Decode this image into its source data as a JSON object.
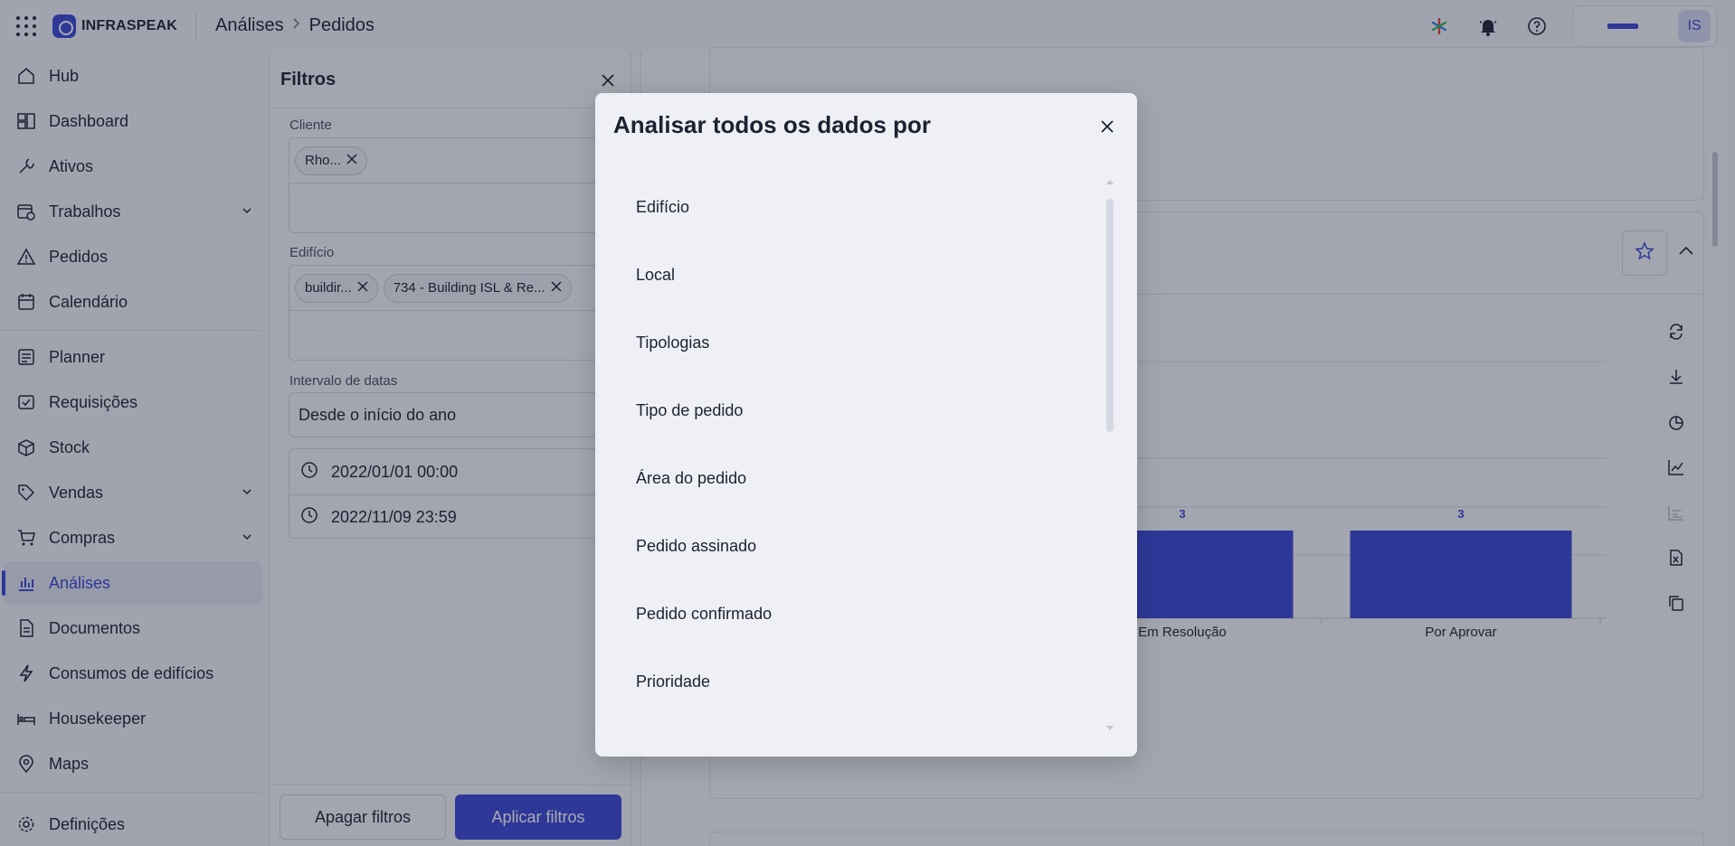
{
  "topbar": {
    "brand": "INFRASPEAK",
    "breadcrumb": [
      "Análises",
      "Pedidos"
    ],
    "avatar_initials": "IS",
    "icons": [
      "apps-grid-icon",
      "ai-sparkle-icon",
      "bell-icon",
      "help-icon"
    ]
  },
  "sidebar": {
    "items": [
      {
        "label": "Hub",
        "icon": "home-icon"
      },
      {
        "label": "Dashboard",
        "icon": "dashboard-icon"
      },
      {
        "label": "Ativos",
        "icon": "wrench-icon"
      },
      {
        "label": "Trabalhos",
        "icon": "calendar-check-icon",
        "expandable": true
      },
      {
        "label": "Pedidos",
        "icon": "warning-icon"
      },
      {
        "label": "Calendário",
        "icon": "calendar-icon"
      },
      {
        "label": "Planner",
        "icon": "planner-icon"
      },
      {
        "label": "Requisições",
        "icon": "requisition-icon"
      },
      {
        "label": "Stock",
        "icon": "box-icon"
      },
      {
        "label": "Vendas",
        "icon": "tag-icon",
        "expandable": true
      },
      {
        "label": "Compras",
        "icon": "cart-icon",
        "expandable": true
      },
      {
        "label": "Análises",
        "icon": "chart-icon",
        "active": true
      },
      {
        "label": "Documentos",
        "icon": "document-icon"
      },
      {
        "label": "Consumos de edifícios",
        "icon": "bolt-icon"
      },
      {
        "label": "Housekeeper",
        "icon": "bed-icon"
      },
      {
        "label": "Maps",
        "icon": "map-pin-icon"
      }
    ],
    "settings_label": "Definições"
  },
  "filters": {
    "title": "Filtros",
    "cliente_label": "Cliente",
    "cliente_chips": [
      "Rho..."
    ],
    "edificio_label": "Edifício",
    "edificio_chips": [
      "buildir...",
      "734 - Building ISL & Re..."
    ],
    "intervalo_label": "Intervalo de datas",
    "intervalo_value": "Desde o início do ano",
    "date_from": "2022/01/01 00:00",
    "date_to": "2022/11/09 23:59",
    "clear_label": "Apagar filtros",
    "apply_label": "Aplicar filtros"
  },
  "chart_data": {
    "type": "bar",
    "categories": [
      "Em Resolução",
      "Por Aprovar"
    ],
    "values": [
      3,
      3
    ],
    "data_labels": [
      "3",
      "3"
    ],
    "title": "",
    "xlabel": "",
    "ylabel": ""
  },
  "modal": {
    "title": "Analisar todos os dados por",
    "options": [
      "Edifício",
      "Local",
      "Tipologias",
      "Tipo de pedido",
      "Área do pedido",
      "Pedido assinado",
      "Pedido confirmado",
      "Prioridade"
    ]
  },
  "colors": {
    "accent": "#3b47d6",
    "overlay": "rgba(26,32,52,0.38)",
    "modal_bg": "#eff0f5"
  }
}
